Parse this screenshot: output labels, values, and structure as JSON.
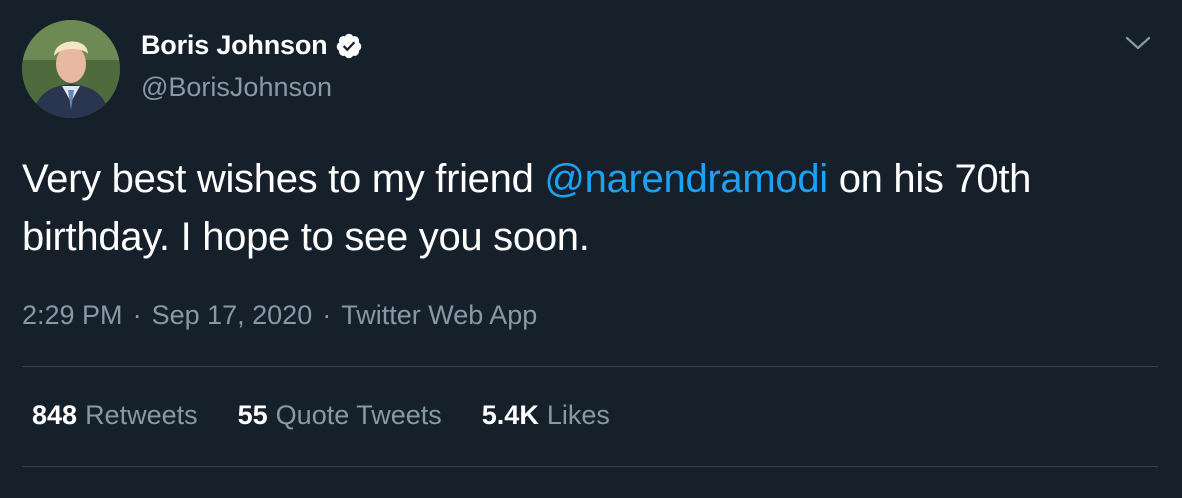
{
  "author": {
    "display_name": "Boris Johnson",
    "handle": "@BorisJohnson",
    "verified": true
  },
  "tweet": {
    "text_before": "Very best wishes to my friend ",
    "mention": "@narendramodi",
    "text_after": " on his 70th birthday. I hope to see you soon."
  },
  "meta": {
    "time": "2:29 PM",
    "separator": "·",
    "date": "Sep 17, 2020",
    "source": "Twitter Web App"
  },
  "stats": {
    "retweets_count": "848",
    "retweets_label": "Retweets",
    "quotes_count": "55",
    "quotes_label": "Quote Tweets",
    "likes_count": "5.4K",
    "likes_label": "Likes"
  },
  "colors": {
    "background": "#15202b",
    "text": "#ffffff",
    "secondary": "#8899a6",
    "accent": "#1da1f2",
    "divider": "#38444d"
  },
  "icons": {
    "verified": "verified-badge-icon",
    "menu": "chevron-down-icon"
  }
}
